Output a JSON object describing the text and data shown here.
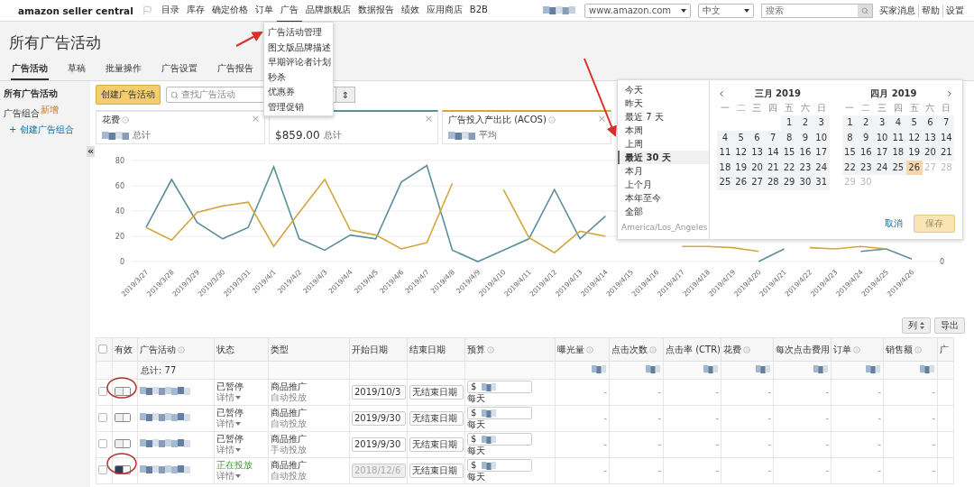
{
  "nav": {
    "logo": "amazon seller central",
    "items": [
      {
        "label": "目录",
        "selected": false
      },
      {
        "label": "库存",
        "selected": false
      },
      {
        "label": "确定价格",
        "selected": false
      },
      {
        "label": "订单",
        "selected": false
      },
      {
        "label": "广告",
        "selected": true
      },
      {
        "label": "品牌旗舰店",
        "selected": false
      },
      {
        "label": "数据报告",
        "selected": false
      },
      {
        "label": "绩效",
        "selected": false
      },
      {
        "label": "应用商店",
        "selected": false
      },
      {
        "label": "B2B",
        "selected": false
      }
    ],
    "marketplace": "www.amazon.com",
    "language": "中文",
    "search_placeholder": "搜索",
    "links": [
      "买家消息",
      "帮助",
      "设置"
    ]
  },
  "ad_menu": {
    "items": [
      "广告活动管理",
      "图文版品牌描述",
      "早期评论者计划",
      "秒杀",
      "优惠券",
      "管理促销"
    ]
  },
  "page_title": "所有广告活动",
  "tabs": [
    {
      "label": "广告活动",
      "selected": true
    },
    {
      "label": "草稿",
      "selected": false
    },
    {
      "label": "批量操作",
      "selected": false
    },
    {
      "label": "广告设置",
      "selected": false
    },
    {
      "label": "广告报告",
      "selected": false
    }
  ],
  "sidebar": {
    "items": [
      {
        "label": "所有广告活动",
        "selected": true
      },
      {
        "label": "广告组合",
        "badge": "新增",
        "selected": false
      }
    ],
    "create_link": "+ 创建广告组合"
  },
  "toolbar": {
    "create_button": "创建广告活动",
    "search_placeholder": "查找广告活动",
    "select_arrow": "⇕"
  },
  "metrics": [
    {
      "title": "花费",
      "blurred": true,
      "suffix": "总计",
      "color": "#e4e4e4",
      "close": "×"
    },
    {
      "value": "$859.00",
      "blurred": false,
      "suffix": "总计",
      "color": "#5b8f99",
      "close": "×"
    },
    {
      "title": "广告投入产出比 (ACOS)",
      "blurred": true,
      "suffix": "平均",
      "color": "#d4a73e",
      "close": "×"
    }
  ],
  "collapse": "«",
  "chart": {
    "right_axis_label": "0",
    "chart_data": {
      "type": "line",
      "grid": true,
      "categories": [
        "2019/3/27",
        "2019/3/28",
        "2019/3/29",
        "2019/3/30",
        "2019/3/31",
        "2019/4/1",
        "2019/4/2",
        "2019/4/3",
        "2019/4/4",
        "2019/4/5",
        "2019/4/6",
        "2019/4/7",
        "2019/4/8",
        "2019/4/9",
        "2019/4/10",
        "2019/4/11",
        "2019/4/12",
        "2019/4/13",
        "2019/4/14",
        "2019/4/15",
        "2019/4/16",
        "2019/4/17",
        "2019/4/18",
        "2019/4/19",
        "2019/4/20",
        "2019/4/21",
        "2019/4/22",
        "2019/4/23",
        "2019/4/24",
        "2019/4/25",
        "2019/4/26"
      ],
      "ylim": [
        0,
        80
      ],
      "yticks": [
        0,
        20,
        40,
        60,
        80
      ],
      "series": [
        {
          "color": "#5b8f99",
          "values": [
            27,
            65,
            31,
            18,
            27,
            75,
            18,
            9,
            21,
            18,
            63,
            76,
            9,
            0,
            9,
            18,
            57,
            18,
            36,
            null,
            null,
            null,
            null,
            null,
            0,
            10,
            null,
            null,
            8,
            10,
            2
          ]
        },
        {
          "color": "#d4a73e",
          "values": [
            27,
            17,
            39,
            44,
            47,
            12,
            39,
            65,
            25,
            21,
            10,
            15,
            62,
            null,
            57,
            19,
            7,
            24,
            20,
            null,
            null,
            12,
            12,
            11,
            8,
            null,
            11,
            10,
            12,
            10,
            null
          ]
        }
      ]
    }
  },
  "date_popup": {
    "presets": [
      {
        "label": "今天",
        "selected": false
      },
      {
        "label": "昨天",
        "selected": false
      },
      {
        "label": "最近 7 天",
        "selected": false
      },
      {
        "label": "本周",
        "selected": false
      },
      {
        "label": "上周",
        "selected": false
      },
      {
        "label": "最近 30 天",
        "selected": true
      },
      {
        "label": "本月",
        "selected": false
      },
      {
        "label": "上个月",
        "selected": false
      },
      {
        "label": "本年至今",
        "selected": false
      },
      {
        "label": "全部",
        "selected": false
      }
    ],
    "timezone": "America/Los_Angeles",
    "months": [
      {
        "title": "三月 2019",
        "weekdays": [
          "一",
          "二",
          "三",
          "四",
          "五",
          "六",
          "日"
        ],
        "weeks": [
          [
            {
              "kind": "blank"
            },
            {
              "kind": "blank"
            },
            {
              "kind": "blank"
            },
            {
              "kind": "blank"
            },
            {
              "kind": "day",
              "label": "1",
              "selected": false,
              "disabled": false
            },
            {
              "kind": "day",
              "label": "2",
              "selected": false,
              "disabled": false
            },
            {
              "kind": "day",
              "label": "3",
              "selected": false,
              "disabled": false
            }
          ],
          [
            {
              "kind": "day",
              "label": "4",
              "selected": false,
              "disabled": false
            },
            {
              "kind": "day",
              "label": "5",
              "selected": false,
              "disabled": false
            },
            {
              "kind": "day",
              "label": "6",
              "selected": false,
              "disabled": false
            },
            {
              "kind": "day",
              "label": "7",
              "selected": false,
              "disabled": false
            },
            {
              "kind": "day",
              "label": "8",
              "selected": false,
              "disabled": false
            },
            {
              "kind": "day",
              "label": "9",
              "selected": false,
              "disabled": false
            },
            {
              "kind": "day",
              "label": "10",
              "selected": false,
              "disabled": false
            }
          ],
          [
            {
              "kind": "day",
              "label": "11",
              "selected": false,
              "disabled": false
            },
            {
              "kind": "day",
              "label": "12",
              "selected": false,
              "disabled": false
            },
            {
              "kind": "day",
              "label": "13",
              "selected": false,
              "disabled": false
            },
            {
              "kind": "day",
              "label": "14",
              "selected": false,
              "disabled": false
            },
            {
              "kind": "day",
              "label": "15",
              "selected": false,
              "disabled": false
            },
            {
              "kind": "day",
              "label": "16",
              "selected": false,
              "disabled": false
            },
            {
              "kind": "day",
              "label": "17",
              "selected": false,
              "disabled": false
            }
          ],
          [
            {
              "kind": "day",
              "label": "18",
              "selected": false,
              "disabled": false
            },
            {
              "kind": "day",
              "label": "19",
              "selected": false,
              "disabled": false
            },
            {
              "kind": "day",
              "label": "20",
              "selected": false,
              "disabled": false
            },
            {
              "kind": "day",
              "label": "21",
              "selected": false,
              "disabled": false
            },
            {
              "kind": "day",
              "label": "22",
              "selected": false,
              "disabled": false
            },
            {
              "kind": "day",
              "label": "23",
              "selected": false,
              "disabled": false
            },
            {
              "kind": "day",
              "label": "24",
              "selected": false,
              "disabled": false
            }
          ],
          [
            {
              "kind": "day",
              "label": "25",
              "selected": false,
              "disabled": false
            },
            {
              "kind": "day",
              "label": "26",
              "selected": false,
              "disabled": false
            },
            {
              "kind": "day",
              "label": "27",
              "selected": false,
              "disabled": false
            },
            {
              "kind": "day",
              "label": "28",
              "selected": false,
              "disabled": false
            },
            {
              "kind": "day",
              "label": "29",
              "selected": false,
              "disabled": false
            },
            {
              "kind": "day",
              "label": "30",
              "selected": false,
              "disabled": false
            },
            {
              "kind": "day",
              "label": "31",
              "selected": false,
              "disabled": false
            }
          ]
        ]
      },
      {
        "title": "四月 2019",
        "weekdays": [
          "一",
          "二",
          "三",
          "四",
          "五",
          "六",
          "日"
        ],
        "weeks": [
          [
            {
              "kind": "day",
              "label": "1",
              "selected": false,
              "disabled": false
            },
            {
              "kind": "day",
              "label": "2",
              "selected": false,
              "disabled": false
            },
            {
              "kind": "day",
              "label": "3",
              "selected": false,
              "disabled": false
            },
            {
              "kind": "day",
              "label": "4",
              "selected": false,
              "disabled": false
            },
            {
              "kind": "day",
              "label": "5",
              "selected": false,
              "disabled": false
            },
            {
              "kind": "day",
              "label": "6",
              "selected": false,
              "disabled": false
            },
            {
              "kind": "day",
              "label": "7",
              "selected": false,
              "disabled": false
            }
          ],
          [
            {
              "kind": "day",
              "label": "8",
              "selected": false,
              "disabled": false
            },
            {
              "kind": "day",
              "label": "9",
              "selected": false,
              "disabled": false
            },
            {
              "kind": "day",
              "label": "10",
              "selected": false,
              "disabled": false
            },
            {
              "kind": "day",
              "label": "11",
              "selected": false,
              "disabled": false
            },
            {
              "kind": "day",
              "label": "12",
              "selected": false,
              "disabled": false
            },
            {
              "kind": "day",
              "label": "13",
              "selected": false,
              "disabled": false
            },
            {
              "kind": "day",
              "label": "14",
              "selected": false,
              "disabled": false
            }
          ],
          [
            {
              "kind": "day",
              "label": "15",
              "selected": false,
              "disabled": false
            },
            {
              "kind": "day",
              "label": "16",
              "selected": false,
              "disabled": false
            },
            {
              "kind": "day",
              "label": "17",
              "selected": false,
              "disabled": false
            },
            {
              "kind": "day",
              "label": "18",
              "selected": false,
              "disabled": false
            },
            {
              "kind": "day",
              "label": "19",
              "selected": false,
              "disabled": false
            },
            {
              "kind": "day",
              "label": "20",
              "selected": false,
              "disabled": false
            },
            {
              "kind": "day",
              "label": "21",
              "selected": false,
              "disabled": false
            }
          ],
          [
            {
              "kind": "day",
              "label": "22",
              "selected": false,
              "disabled": false
            },
            {
              "kind": "day",
              "label": "23",
              "selected": false,
              "disabled": false
            },
            {
              "kind": "day",
              "label": "24",
              "selected": false,
              "disabled": false
            },
            {
              "kind": "day",
              "label": "25",
              "selected": false,
              "disabled": false
            },
            {
              "kind": "day",
              "label": "26",
              "selected": true,
              "disabled": false
            },
            {
              "kind": "day",
              "label": "27",
              "selected": false,
              "disabled": true
            },
            {
              "kind": "day",
              "label": "28",
              "selected": false,
              "disabled": true
            }
          ],
          [
            {
              "kind": "day",
              "label": "29",
              "selected": false,
              "disabled": true
            },
            {
              "kind": "day",
              "label": "30",
              "selected": false,
              "disabled": true
            }
          ]
        ]
      }
    ],
    "cancel": "取消",
    "save": {
      "label": "保存",
      "disabled": true
    }
  },
  "table_actions": {
    "columns_button": "列",
    "export_button": "导出"
  },
  "table": {
    "columns": [
      {
        "label": "有效",
        "info": false
      },
      {
        "label": "广告活动",
        "info": true
      },
      {
        "label": "状态",
        "info": false
      },
      {
        "label": "类型",
        "info": false
      },
      {
        "label": "开始日期",
        "info": false
      },
      {
        "label": "结束日期",
        "info": false
      },
      {
        "label": "预算",
        "info": true
      },
      {
        "label": "曝光量",
        "info": true
      },
      {
        "label": "点击次数",
        "info": true
      },
      {
        "label": "点击率 (CTR)",
        "info": false
      },
      {
        "label": "花费",
        "info": true
      },
      {
        "label": "每次点击费用",
        "info": false
      },
      {
        "label": "订单",
        "info": true
      },
      {
        "label": "销售额",
        "info": true
      },
      {
        "label": "广",
        "info": false
      }
    ],
    "select_all_checked": false,
    "total": "总计: 77",
    "rows": [
      {
        "checked": false,
        "enabled": false,
        "status": "已暂停",
        "active": false,
        "details": "详情",
        "type": "商品推广",
        "targeting": "自动投放",
        "start_date": "2019/10/3",
        "start_editable": true,
        "end_date": "无结束日期",
        "currency": "$",
        "budget_period": "每天",
        "metrics": [
          "-",
          "-",
          "-",
          "-",
          "-",
          "-",
          "-"
        ]
      },
      {
        "checked": false,
        "enabled": false,
        "status": "已暂停",
        "active": false,
        "details": "详情",
        "type": "商品推广",
        "targeting": "自动投放",
        "start_date": "2019/9/30",
        "start_editable": true,
        "end_date": "无结束日期",
        "currency": "$",
        "budget_period": "每天",
        "metrics": [
          "-",
          "-",
          "-",
          "-",
          "-",
          "-",
          "-"
        ]
      },
      {
        "checked": false,
        "enabled": false,
        "status": "已暂停",
        "active": false,
        "details": "详情",
        "type": "商品推广",
        "targeting": "手动投放",
        "start_date": "2019/9/30",
        "start_editable": true,
        "end_date": "无结束日期",
        "currency": "$",
        "budget_period": "每天",
        "metrics": [
          "-",
          "-",
          "-",
          "-",
          "-",
          "-",
          "-"
        ]
      },
      {
        "checked": false,
        "enabled": true,
        "status": "正在投放",
        "active": true,
        "details": "详情",
        "type": "商品推广",
        "targeting": "自动投放",
        "start_date": "2018/12/6",
        "start_editable": false,
        "end_date": "无结束日期",
        "currency": "$",
        "budget_period": "每天",
        "metrics": [
          "-",
          "-",
          "-",
          "-",
          "-",
          "-",
          "-"
        ]
      }
    ]
  }
}
